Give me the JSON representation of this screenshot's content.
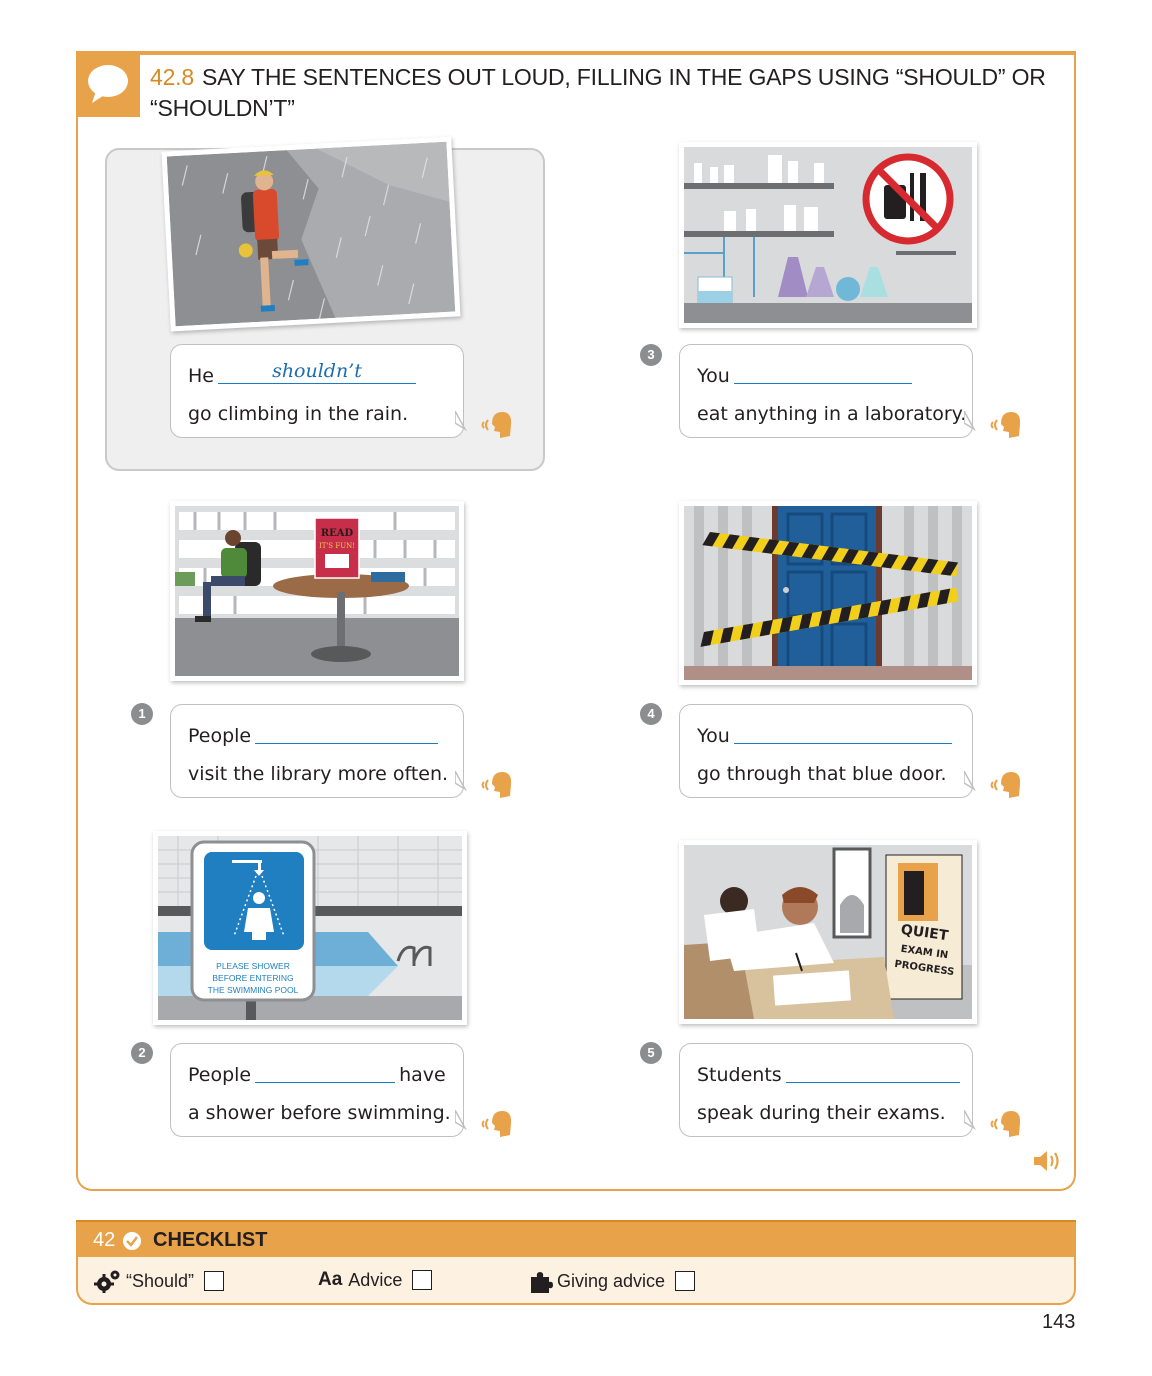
{
  "exercise": {
    "number": "42.8",
    "title": "SAY THE SENTENCES OUT LOUD, FILLING IN THE GAPS USING “SHOULD” OR “SHOULDN’T”"
  },
  "items": [
    {
      "number": "",
      "before": "He",
      "answer": "shouldn’t",
      "after": "",
      "line2": "go climbing in the rain."
    },
    {
      "number": "1",
      "before": "People",
      "answer": "",
      "after": "",
      "line2": "visit the library more often."
    },
    {
      "number": "2",
      "before": "People",
      "answer": "",
      "after": "have",
      "line2": "a shower before swimming."
    },
    {
      "number": "3",
      "before": "You",
      "answer": "",
      "after": "",
      "line2": "eat anything in a laboratory."
    },
    {
      "number": "4",
      "before": "You",
      "answer": "",
      "after": "",
      "line2": "go through that blue door."
    },
    {
      "number": "5",
      "before": "Students",
      "answer": "",
      "after": "",
      "line2": "speak during their exams."
    }
  ],
  "images": {
    "library_sign": "READ IT'S FUN!",
    "pool_sign": [
      "PLEASE SHOWER",
      "BEFORE ENTERING",
      "THE SWIMMING POOL"
    ],
    "exam_sign": [
      "QUIET",
      "EXAM IN",
      "PROGRESS"
    ]
  },
  "checklist": {
    "number": "42",
    "title": "CHECKLIST",
    "items": [
      {
        "icon": "gears-icon",
        "label": "“Should”",
        "checked": false
      },
      {
        "icon": "aa-icon",
        "prefix": "Aa",
        "label": "Advice",
        "checked": false
      },
      {
        "icon": "puzzle-icon",
        "label": "Giving advice",
        "checked": false
      }
    ]
  },
  "page_number": "143",
  "colors": {
    "accent": "#e8a34a",
    "answer_blue": "#1a6db3",
    "line_blue": "#1a7bc1",
    "panel_grey": "#efeff0"
  }
}
